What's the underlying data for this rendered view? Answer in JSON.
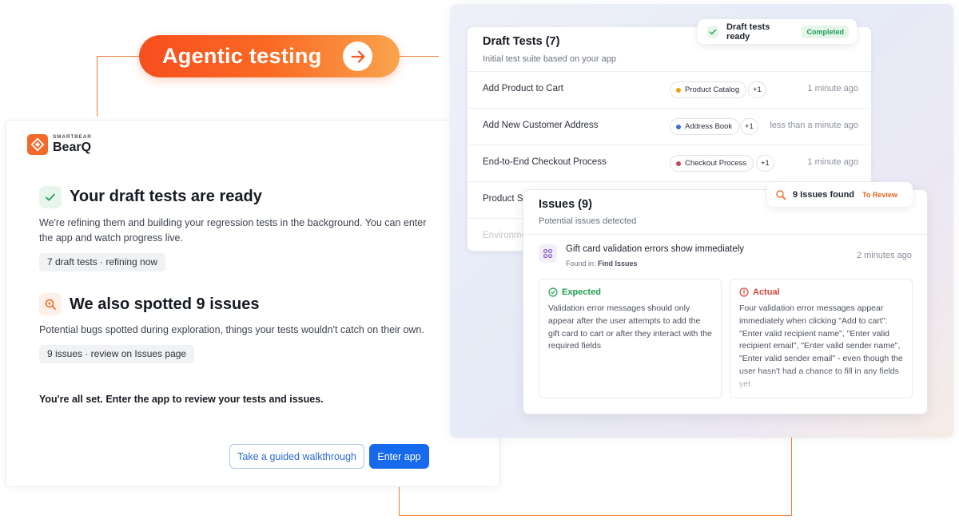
{
  "pill": {
    "label": "Agentic testing",
    "icon": "arrow-right-icon"
  },
  "left": {
    "brand_small": "SMARTBEAR",
    "brand_name": "BearQ",
    "section1": {
      "title": "Your draft tests are ready",
      "body_line1": "We're refining them and building your regression tests in the background. You can enter",
      "body_line2": "the app and watch progress live.",
      "chip": "7 draft tests · refining now"
    },
    "section2": {
      "title": "We also spotted 9 issues",
      "body": "Potential bugs spotted during exploration, things your tests wouldn't catch on their own.",
      "chip": "9 issues · review on Issues page"
    },
    "final_text": "You're all set. Enter the app to review your tests and issues.",
    "btn_walkthrough": "Take a guided walkthrough",
    "btn_enter": "Enter app"
  },
  "draft": {
    "title": "Draft Tests (7)",
    "subtitle": "Initial test suite based on your app",
    "badge": {
      "text": "Draft tests ready",
      "status": "Completed"
    },
    "rows": [
      {
        "name": "Add Product to Cart",
        "tag": "Product Catalog",
        "tag_color": "#f59e0b",
        "extra": "+1",
        "time": "1 minute ago"
      },
      {
        "name": "Add New Customer Address",
        "tag": "Address Book",
        "tag_color": "#3b6fd8",
        "extra": "+1",
        "time": "less than a minute ago"
      },
      {
        "name": "End-to-End Checkout Process",
        "tag": "Checkout Process",
        "tag_color": "#c0465a",
        "extra": "+1",
        "time": "1 minute ago"
      },
      {
        "name": "Product S",
        "tag": "",
        "tag_color": "",
        "extra": "",
        "time": ""
      },
      {
        "name": "Environme",
        "tag": "",
        "tag_color": "",
        "extra": "",
        "time": ""
      }
    ]
  },
  "issues": {
    "title": "Issues (9)",
    "subtitle": "Potential issues detected",
    "badge": {
      "text": "9 Issues found",
      "status": "To Review"
    },
    "item": {
      "title": "Gift card validation errors show immediately",
      "found_label": "Found in:",
      "found_value": "Find Issues",
      "time": "2 minutes ago"
    },
    "expected": {
      "label": "Expected",
      "text": "Validation error messages should only appear after the user attempts to add the gift card to cart or after they interact with the required fields"
    },
    "actual": {
      "label": "Actual",
      "text": "Four validation error messages appear immediately when clicking \"Add to cart\": \"Enter valid recipient name\", \"Enter valid recipient email\", \"Enter valid sender name\", \"Enter valid sender email\" - even though the user hasn't had a chance to fill in any fields yet"
    }
  },
  "colors": {
    "accent": "#f26a2a",
    "primary": "#1769ee",
    "success": "#1f9d55",
    "danger": "#d6453d"
  }
}
